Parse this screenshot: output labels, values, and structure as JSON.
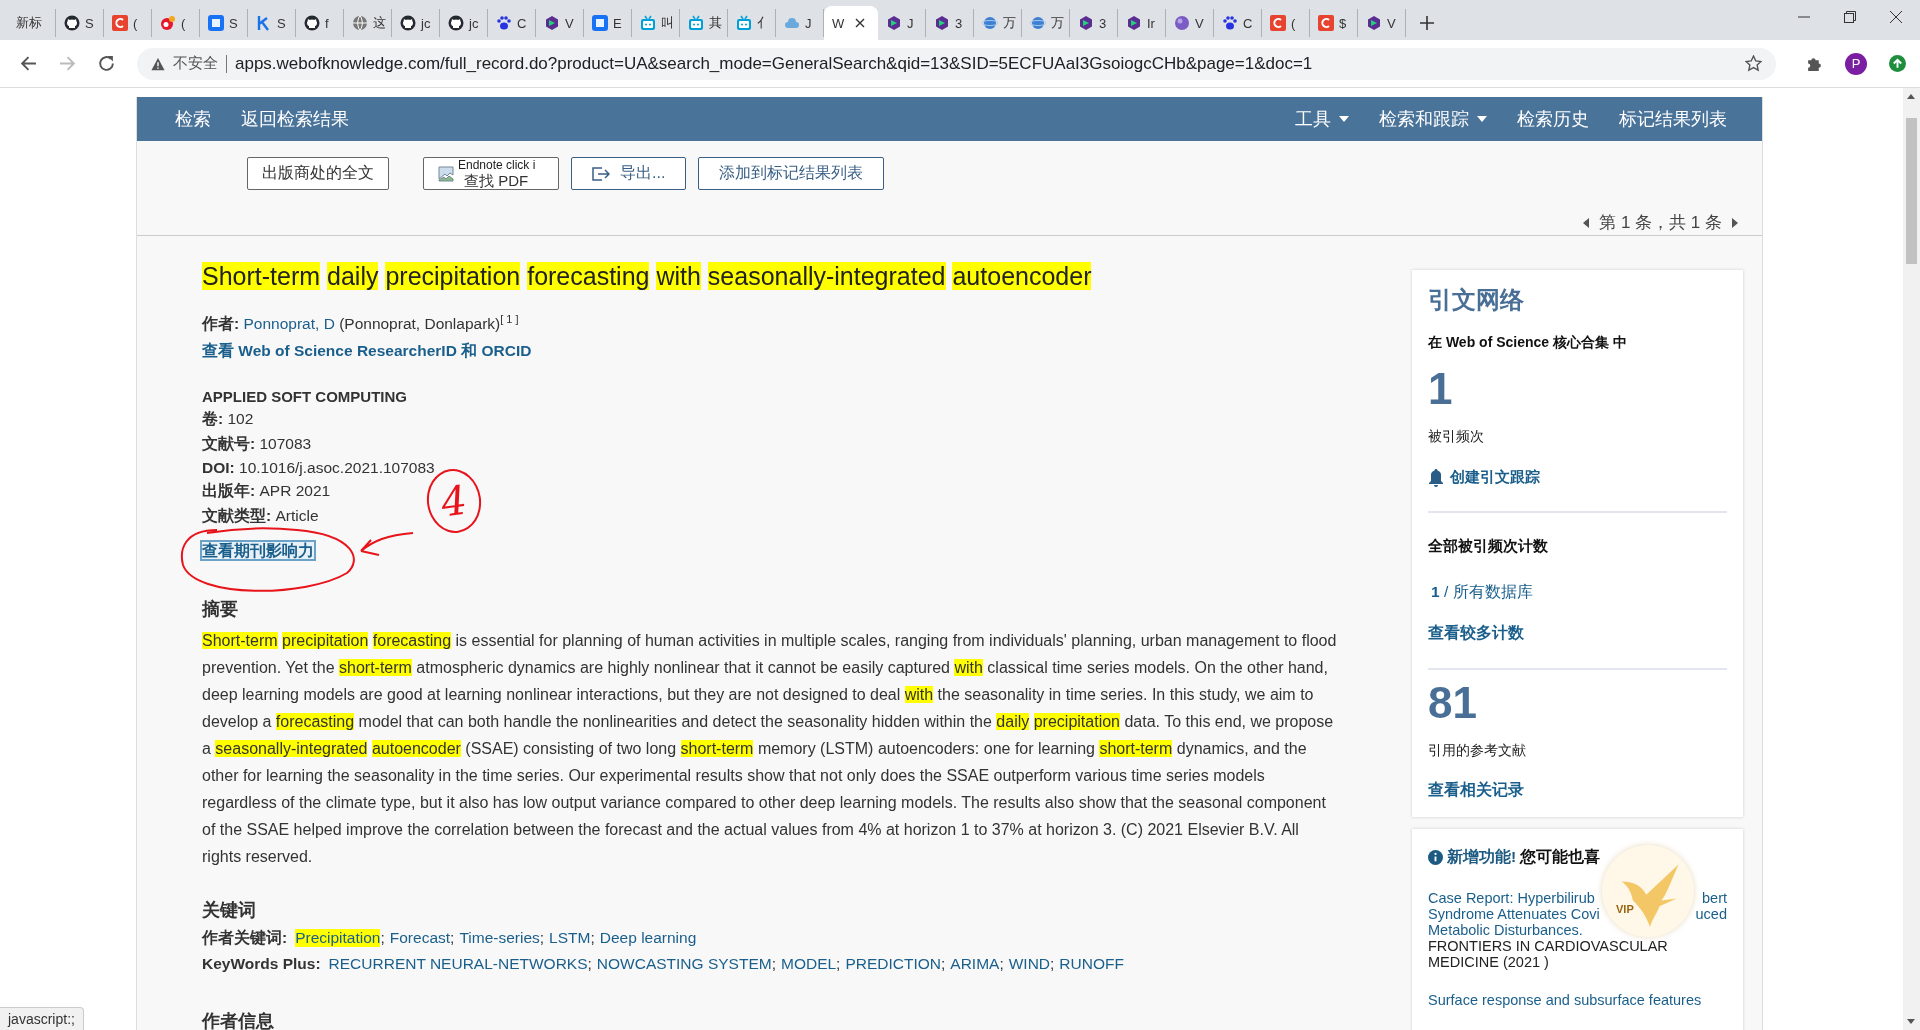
{
  "tabs": [
    {
      "kind": "none",
      "label": "新标",
      "selected": false
    },
    {
      "kind": "github",
      "label": "S",
      "selected": false
    },
    {
      "kind": "red-square",
      "label": "(",
      "selected": false
    },
    {
      "kind": "red-round",
      "label": "(",
      "selected": false
    },
    {
      "kind": "blue-square",
      "label": "S",
      "selected": false
    },
    {
      "kind": "k-mark",
      "label": "S",
      "selected": false
    },
    {
      "kind": "github",
      "label": "f",
      "selected": false
    },
    {
      "kind": "globe",
      "label": "这",
      "selected": false
    },
    {
      "kind": "github",
      "label": "jc",
      "selected": false
    },
    {
      "kind": "github",
      "label": "jc",
      "selected": false
    },
    {
      "kind": "paw",
      "label": "C",
      "selected": false
    },
    {
      "kind": "hex",
      "label": "V",
      "selected": false
    },
    {
      "kind": "blue-square",
      "label": "E",
      "selected": false
    },
    {
      "kind": "tv",
      "label": "叫",
      "selected": false
    },
    {
      "kind": "tv",
      "label": "其",
      "selected": false
    },
    {
      "kind": "tv",
      "label": "亻",
      "selected": false
    },
    {
      "kind": "cloud",
      "label": "J",
      "selected": false
    },
    {
      "kind": "none",
      "label": "W",
      "selected": true
    },
    {
      "kind": "hex",
      "label": "J",
      "selected": false
    },
    {
      "kind": "hex",
      "label": "3",
      "selected": false
    },
    {
      "kind": "planet",
      "label": "万",
      "selected": false
    },
    {
      "kind": "planet",
      "label": "万",
      "selected": false
    },
    {
      "kind": "hex",
      "label": "3",
      "selected": false
    },
    {
      "kind": "hex",
      "label": "Ir",
      "selected": false
    },
    {
      "kind": "ball",
      "label": "V",
      "selected": false
    },
    {
      "kind": "paw",
      "label": "C",
      "selected": false
    },
    {
      "kind": "red-square",
      "label": "(",
      "selected": false
    },
    {
      "kind": "red-square",
      "label": "$",
      "selected": false
    },
    {
      "kind": "hex",
      "label": "V",
      "selected": false
    }
  ],
  "address_bar": {
    "security": "不安全",
    "url": "apps.webofknowledge.com/full_record.do?product=UA&search_mode=GeneralSearch&qid=13&SID=5ECFUAaI3GsoiogcCHb&page=1&doc=1",
    "profile": "P"
  },
  "nav": {
    "left": [
      "检索",
      "返回检索结果"
    ],
    "right": [
      {
        "label": "工具",
        "dropdown": true
      },
      {
        "label": "检索和跟踪",
        "dropdown": true
      },
      {
        "label": "检索历史",
        "dropdown": false
      },
      {
        "label": "标记结果列表",
        "dropdown": false
      }
    ]
  },
  "toolbar": {
    "fulltext": "出版商处的全文",
    "pdf": "查找 PDF",
    "pdf_alt": "Endnote click i",
    "export": "导出...",
    "add_marked": "添加到标记结果列表"
  },
  "pagination": "第 1 条，共 1 条",
  "title": [
    {
      "text": "Short-term",
      "highlight": true
    },
    {
      "text": "daily",
      "highlight": true
    },
    {
      "text": "precipitation",
      "highlight": true
    },
    {
      "text": "forecasting",
      "highlight": true
    },
    {
      "text": "with",
      "highlight": true
    },
    {
      "text": "seasonally-integrated",
      "highlight": true
    },
    {
      "text": "autoencoder",
      "highlight": true
    }
  ],
  "author": {
    "label": "作者:",
    "name": "Ponnoprat, D",
    "full": "(Ponnoprat, Donlapark)",
    "ref": "[ 1 ]"
  },
  "researcher_link": "查看 Web of Science ResearcherID 和 ORCID",
  "journal": "APPLIED SOFT COMPUTING",
  "fields": [
    {
      "label": "卷:",
      "value": "102"
    },
    {
      "label": "文献号:",
      "value": "107083"
    },
    {
      "label": "DOI:",
      "value": "10.1016/j.asoc.2021.107083"
    },
    {
      "label": "出版年:",
      "value": "APR 2021"
    },
    {
      "label": "文献类型:",
      "value": "Article"
    }
  ],
  "impact_link": "查看期刊影响力",
  "annotation": {
    "label": "4"
  },
  "abstract": {
    "heading": "摘要",
    "segments": [
      {
        "text": "Short-term",
        "highlight": true,
        "space_after": true
      },
      {
        "text": "precipitation",
        "highlight": true,
        "space_after": true
      },
      {
        "text": "forecasting",
        "highlight": true
      },
      {
        "text": " is essential for planning of human activities in multiple scales, ranging from individuals' planning, urban management to flood prevention. Yet the ",
        "highlight": false
      },
      {
        "text": "short-term",
        "highlight": true
      },
      {
        "text": " atmospheric dynamics are highly nonlinear that it cannot be easily captured ",
        "highlight": false
      },
      {
        "text": "with",
        "highlight": true
      },
      {
        "text": " classical time series models. On the other hand, deep learning models are good at learning nonlinear interactions, but they are not designed to deal ",
        "highlight": false
      },
      {
        "text": "with",
        "highlight": true
      },
      {
        "text": " the seasonality in time series. In this study, we aim to develop a ",
        "highlight": false
      },
      {
        "text": "forecasting",
        "highlight": true
      },
      {
        "text": " model that can both handle the nonlinearities and detect the seasonality hidden within the ",
        "highlight": false
      },
      {
        "text": "daily",
        "highlight": true,
        "space_after": true
      },
      {
        "text": "precipitation",
        "highlight": true
      },
      {
        "text": " data. To this end, we propose a ",
        "highlight": false
      },
      {
        "text": "seasonally-integrated",
        "highlight": true,
        "space_after": true
      },
      {
        "text": "autoencoder",
        "highlight": true
      },
      {
        "text": " (SSAE) consisting of two long ",
        "highlight": false
      },
      {
        "text": "short-term",
        "highlight": true
      },
      {
        "text": " memory (LSTM) autoencoders: one for learning ",
        "highlight": false
      },
      {
        "text": "short-term",
        "highlight": true
      },
      {
        "text": " dynamics, and the other for learning the seasonality in the time series. Our experimental results show that not only does the SSAE outperform various time series models regardless of the climate type, but it also has low output variance compared to other deep learning models. The results also show that the seasonal component of the SSAE helped improve the correlation between the forecast and the actual values from 4% at horizon 1 to 37% at horizon 3. (C) 2021 Elsevier B.V. All rights reserved.",
        "highlight": false
      }
    ]
  },
  "keywords": {
    "heading": "关键词",
    "separator": ";",
    "author_label": "作者关键词:",
    "author": [
      {
        "text": "Precipitation",
        "highlight": true
      },
      {
        "text": "Forecast",
        "highlight": false
      },
      {
        "text": "Time-series",
        "highlight": false
      },
      {
        "text": "LSTM",
        "highlight": false
      },
      {
        "text": "Deep learning",
        "highlight": false
      }
    ],
    "plus_label": "KeyWords Plus:",
    "plus": [
      "RECURRENT NEURAL-NETWORKS",
      "NOWCASTING SYSTEM",
      "MODEL",
      "PREDICTION",
      "ARIMA",
      "WIND",
      "RUNOFF"
    ]
  },
  "author_info_heading": "作者信息",
  "citation_network": {
    "title": "引文网络",
    "scope": "在 Web of Science 核心合集 中",
    "times_cited": "1",
    "times_cited_label": "被引频次",
    "alert_link": "创建引文跟踪",
    "all_counts_heading": "全部被引频次计数",
    "all_db_count": "1",
    "all_db_label": "/ 所有数据库",
    "more_counts_link": "查看较多计数",
    "references": "81",
    "references_label": "引用的参考文献",
    "related_link": "查看相关记录"
  },
  "suggestions": {
    "heading_new": "新增功能!",
    "heading": "您可能也喜",
    "vip_badge": "VIP",
    "items": [
      {
        "title_lines": [
          [
            "Case Report: Hyperbilirub",
            "bert"
          ],
          [
            "Syndrome Attenuates Covi",
            "uced"
          ],
          [
            "Metabolic Disturbances."
          ]
        ],
        "source_lines": [
          "FRONTIERS IN CARDIOVASCULAR",
          "MEDICINE (2021 )"
        ]
      },
      {
        "title_lines": [
          [
            "Surface response and subsurface features"
          ]
        ]
      }
    ]
  },
  "status": "javascript:;"
}
